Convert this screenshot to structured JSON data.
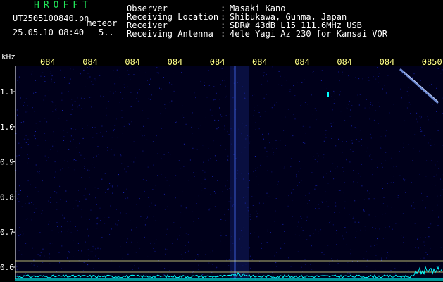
{
  "app": {
    "title": "HROFFT"
  },
  "file": {
    "name": "UT2505100840.pn",
    "mode": "meteor",
    "datetime": "25.05.10 08:40",
    "value": "5.."
  },
  "info": [
    {
      "key": "Observer",
      "value": "Masaki Kano"
    },
    {
      "key": "Receiving Location",
      "value": "Shibukawa, Gunma, Japan"
    },
    {
      "key": "Receiver",
      "value": "SDR# 43dB L15 111.6MHz USB"
    },
    {
      "key": "Receiving Antenna",
      "value": "4ele Yagi Az 230 for Kansai VOR"
    }
  ],
  "plot": {
    "y_unit": "kHz",
    "y_ticks": [
      "1.1",
      "1.0",
      "0.9",
      "0.8",
      "0.7",
      "0.6"
    ],
    "time_labels": [
      "084",
      "084",
      "084",
      "084",
      "084",
      "084",
      "084",
      "084",
      "084",
      "0850"
    ],
    "colors": {
      "background": "#00001a",
      "labels": "#ffff88",
      "axis": "#ffffff",
      "signal": "#00ffff",
      "marker_line": "#ffff99",
      "bright_streak": "#88aaff"
    }
  }
}
